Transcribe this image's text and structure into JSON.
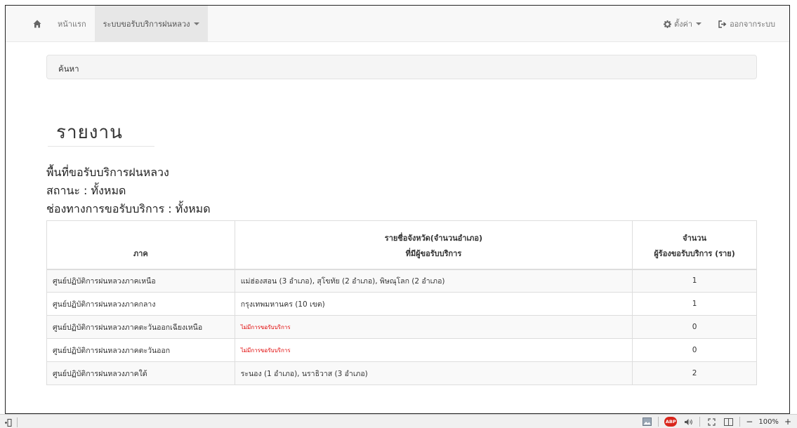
{
  "navbar": {
    "home_icon": "home-icon",
    "menu_home": "หน้าแรก",
    "menu_service": "ระบบขอรับบริการฝนหลวง",
    "settings": "ตั้งค่า",
    "settings_icon": "gear-icon",
    "logout": "ออกจากระบบ",
    "logout_icon": "logout-icon"
  },
  "search": {
    "label": "ค้นหา"
  },
  "report": {
    "title": "รายงาน",
    "area": "พื้นที่ขอรับบริการฝนหลวง",
    "status": "สถานะ : ทั้งหมด",
    "channel": "ช่องทางการขอรับบริการ : ทั้งหมด"
  },
  "table": {
    "headers": {
      "region": "ภาค",
      "provinces_line1": "รายชื่อจังหวัด(จำนวนอำเภอ)",
      "provinces_line2": "ที่มีผู้ขอรับบริการ",
      "count_line1": "จำนวน",
      "count_line2": "ผู้ร้องขอรับบริการ (ราย)"
    },
    "rows": [
      {
        "region": "ศูนย์ปฏิบัติการฝนหลวงภาคเหนือ",
        "provinces": "แม่ฮ่องสอน (3 อำเภอ), สุโขทัย (2 อำเภอ), พิษณุโลก (2 อำเภอ)",
        "count": "1"
      },
      {
        "region": "ศูนย์ปฏิบัติการฝนหลวงภาคกลาง",
        "provinces": "กรุงเทพมหานคร (10 เขต)",
        "count": "1"
      },
      {
        "region": "ศูนย์ปฏิบัติการฝนหลวงภาคตะวันออกเฉียงเหนือ",
        "provinces": "ไม่มีการขอรับบริการ",
        "count": "0"
      },
      {
        "region": "ศูนย์ปฏิบัติการฝนหลวงภาคตะวันออก",
        "provinces": "ไม่มีการขอรับบริการ",
        "count": "0"
      },
      {
        "region": "ศูนย์ปฏิบัติการฝนหลวงภาคใต้",
        "provinces": "ระนอง (1 อำเภอ), นราธิวาส (3 อำเภอ)",
        "count": "2"
      }
    ]
  },
  "statusbar": {
    "zoom": "100%",
    "zoom_minus": "−",
    "zoom_plus": "+",
    "abp_label": "ABP"
  },
  "colors": {
    "no_service": "#e00000",
    "navbar_bg": "#f8f8f8",
    "active_menu_bg": "#e7e7e7"
  }
}
